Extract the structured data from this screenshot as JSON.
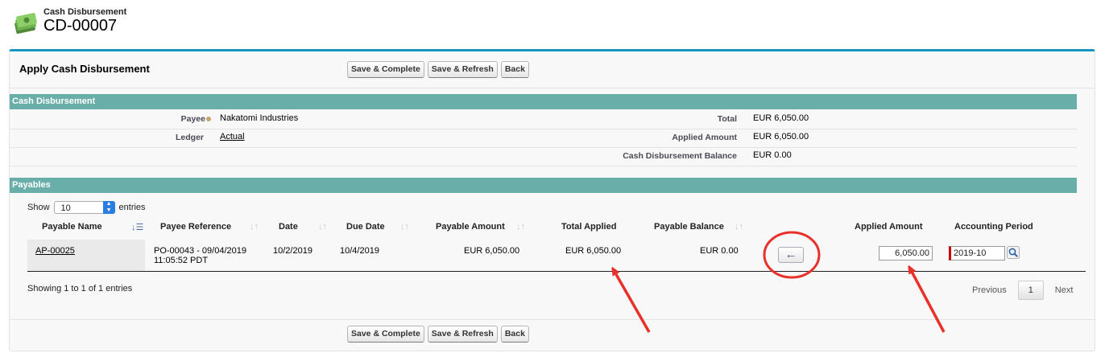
{
  "header": {
    "record_type": "Cash Disbursement",
    "record_name": "CD-00007",
    "icon": "money-stack-icon"
  },
  "page": {
    "title": "Apply Cash Disbursement",
    "buttons": {
      "save_complete": "Save & Complete",
      "save_refresh": "Save & Refresh",
      "back": "Back"
    }
  },
  "cash_disbursement": {
    "section_title": "Cash Disbursement",
    "payee_label": "Payee",
    "payee_value": "Nakatomi Industries",
    "ledger_label": "Ledger",
    "ledger_value": "Actual",
    "total_label": "Total",
    "total_value": "EUR  6,050.00",
    "applied_label": "Applied Amount",
    "applied_value": "EUR  6,050.00",
    "balance_label": "Cash Disbursement Balance",
    "balance_value": "EUR  0.00"
  },
  "payables": {
    "section_title": "Payables",
    "show_label": "Show",
    "page_size": "10",
    "entries_label": "entries",
    "columns": {
      "payable_name": "Payable Name",
      "payee_reference": "Payee Reference",
      "date": "Date",
      "due_date": "Due Date",
      "payable_amount": "Payable Amount",
      "total_applied": "Total Applied",
      "payable_balance": "Payable Balance",
      "applied_amount": "Applied Amount",
      "accounting_period": "Accounting Period"
    },
    "rows": [
      {
        "payable_name": "AP-00025",
        "payee_reference_line1": "PO-00043 - 09/04/2019",
        "payee_reference_line2": "11:05:52 PDT",
        "date": "10/2/2019",
        "due_date": "10/4/2019",
        "payable_amount": "EUR  6,050.00",
        "total_applied": "EUR  6,050.00",
        "payable_balance": "EUR  0.00",
        "applied_amount": "6,050.00",
        "accounting_period": "2019-10"
      }
    ],
    "info": "Showing 1 to 1 of 1 entries",
    "pager": {
      "previous": "Previous",
      "current": "1",
      "next": "Next"
    }
  },
  "annotation_color": "#e8312a"
}
